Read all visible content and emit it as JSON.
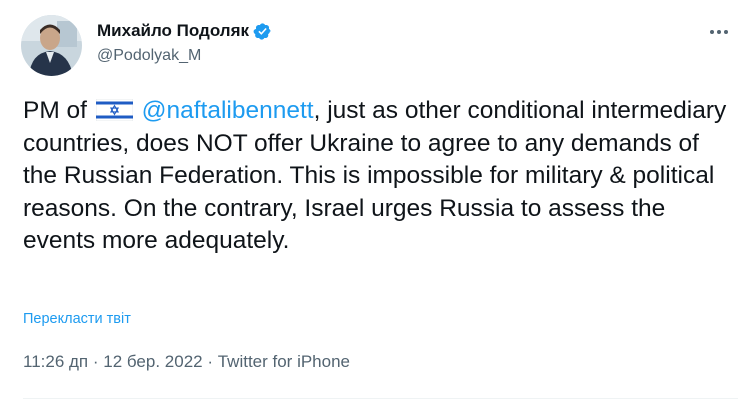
{
  "author": {
    "name": "Михайло Подоляк",
    "handle": "@Podolyak_M",
    "verified": true
  },
  "tweet": {
    "text_before_flag": "PM of ",
    "flag": "flag-israel-icon",
    "mention": "@naftalibennett",
    "text_after_mention": ", just as other conditional intermediary countries, does NOT offer Ukraine to agree to any demands of the Russian Federation. This is impossible for military & political reasons. On the contrary, Israel urges Russia to assess the events more adequately."
  },
  "translate_label": "Перекласти твіт",
  "meta": {
    "time": "11:26 дп",
    "separator": " · ",
    "date": "12 бер. 2022",
    "source": "Twitter for iPhone"
  },
  "colors": {
    "accent": "#1d9bf0",
    "text": "#0f1419",
    "muted": "#536471"
  }
}
